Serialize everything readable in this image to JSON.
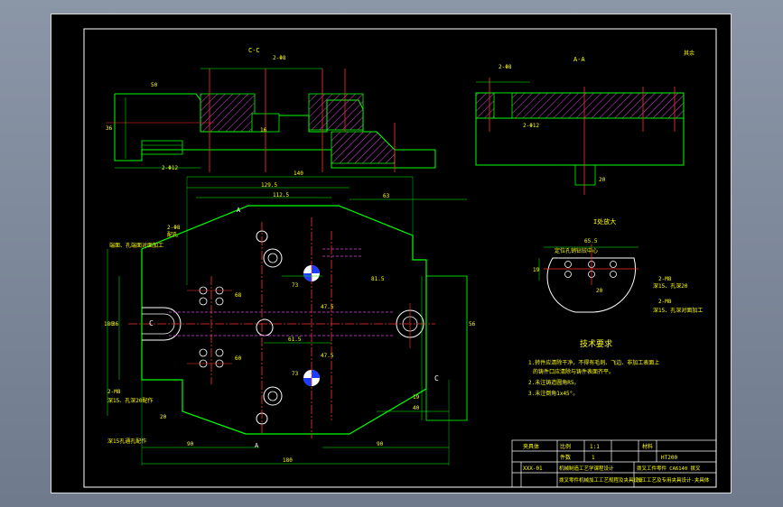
{
  "sections": {
    "cc": "C-C",
    "aa": "A-A",
    "enlarged": "I处放大"
  },
  "roughness_note": "其余",
  "tech": {
    "title": "技术要求",
    "line1": "1.转件应清除干净，不得有毛刺、飞边、非加工表面上",
    "line2": "的铸件口应清除与铸件表面齐平。",
    "line3": "2.未注铸造圆角R5。",
    "line4": "3.未注倒角1x45°。"
  },
  "callouts": {
    "c1": "2-Φ8",
    "c1b": "配孔",
    "c2": "端面、孔端面对面加工",
    "c3": "2-M8",
    "c4": "深15、孔深20配作",
    "c5": "深15孔通孔配作",
    "c6": "定位孔销钻铰中心",
    "c7": "2-M8",
    "c8": "深15、孔深20",
    "c9": "深15、孔深对面加工",
    "c10": "2-Φ8",
    "c11": "2-Φ12"
  },
  "dims": {
    "d_140": "140",
    "d_129": "129.5",
    "d_112": "112.5",
    "d_63": "63",
    "d_81_5": "81.5",
    "d_73": "73",
    "d_61_5": "61.5",
    "d_47_5": "47.5",
    "d_36": "36",
    "d_90a": "90",
    "d_90b": "90",
    "d_180": "180",
    "d_20": "20",
    "d_56": "56",
    "d_40": "40",
    "d_19": "19",
    "d_60": "60",
    "d_68": "68",
    "d_80": "80",
    "d_65_5": "65.5",
    "d_50": "50",
    "d_16": "16",
    "d_c": "C",
    "d_a": "A"
  },
  "title_block": {
    "designer": "夹具体",
    "drawing_no": "XXX-01",
    "scale_label": "比例",
    "scale": "1:1",
    "qty_label": "件数",
    "qty": "1",
    "material_label": "材料",
    "material": "HT200",
    "company1": "机械制造工艺学课程设计",
    "company2": "拨叉零件机械加工工艺规程及夹具设计",
    "desc1": "拨叉工件零件 CA6140 拨叉",
    "desc2": "加工工艺及专用夹具设计-夹具体"
  }
}
